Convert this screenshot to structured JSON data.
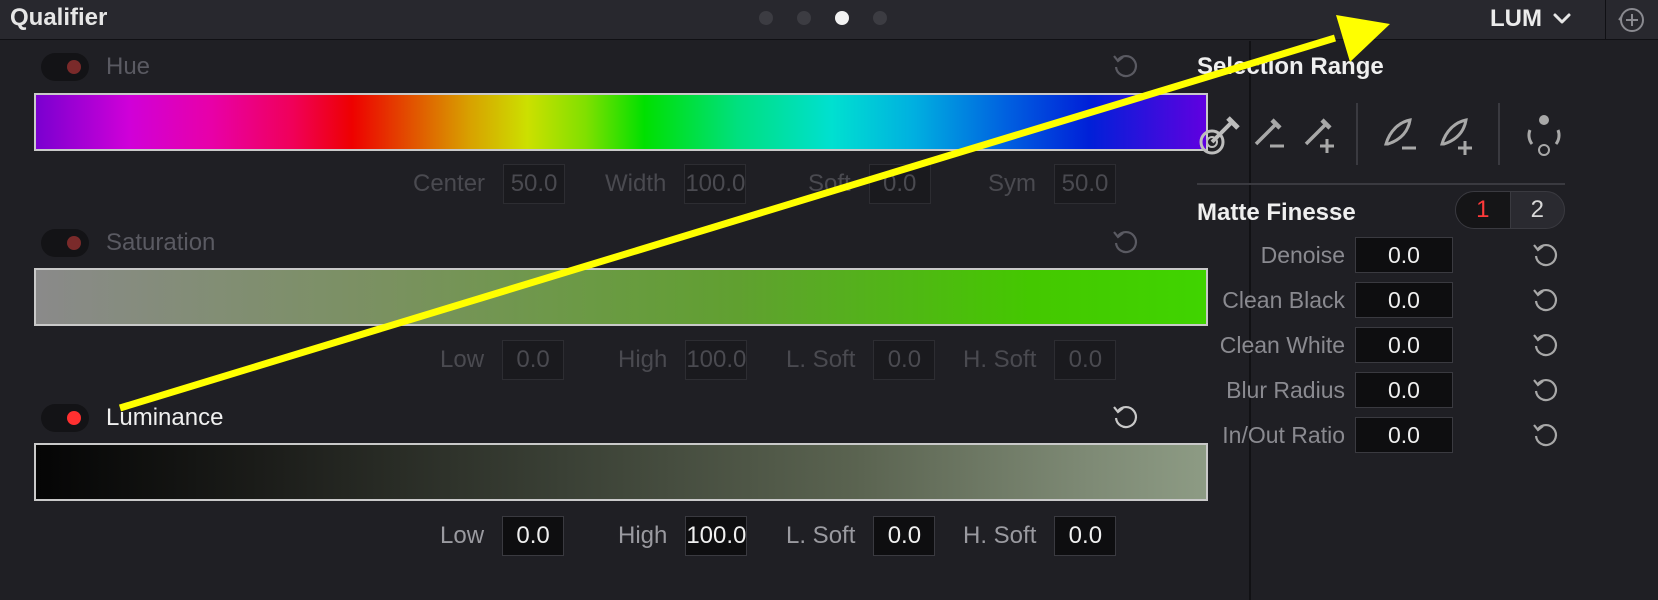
{
  "header": {
    "title": "Qualifier",
    "mode": "LUM",
    "page_dots": 4,
    "active_dot": 3
  },
  "hue": {
    "label": "Hue",
    "enabled": false,
    "params": [
      {
        "label": "Center",
        "value": "50.0"
      },
      {
        "label": "Width",
        "value": "100.0"
      },
      {
        "label": "Soft",
        "value": "0.0"
      },
      {
        "label": "Sym",
        "value": "50.0"
      }
    ]
  },
  "saturation": {
    "label": "Saturation",
    "enabled": false,
    "params": [
      {
        "label": "Low",
        "value": "0.0"
      },
      {
        "label": "High",
        "value": "100.0"
      },
      {
        "label": "L. Soft",
        "value": "0.0"
      },
      {
        "label": "H. Soft",
        "value": "0.0"
      }
    ]
  },
  "luminance": {
    "label": "Luminance",
    "enabled": true,
    "params": [
      {
        "label": "Low",
        "value": "0.0"
      },
      {
        "label": "High",
        "value": "100.0"
      },
      {
        "label": "L. Soft",
        "value": "0.0"
      },
      {
        "label": "H. Soft",
        "value": "0.0"
      }
    ]
  },
  "selection_range": {
    "title": "Selection Range",
    "tools": [
      "picker-icon",
      "picker-minus-icon",
      "picker-plus-icon",
      "feather-minus-icon",
      "feather-plus-icon",
      "invert-icon"
    ]
  },
  "matte_finesse": {
    "title": "Matte Finesse",
    "tabs": [
      "1",
      "2"
    ],
    "active_tab": "1",
    "rows": [
      {
        "label": "Denoise",
        "value": "0.0"
      },
      {
        "label": "Clean Black",
        "value": "0.0"
      },
      {
        "label": "Clean White",
        "value": "0.0"
      },
      {
        "label": "Blur Radius",
        "value": "0.0"
      },
      {
        "label": "In/Out Ratio",
        "value": "0.0"
      }
    ]
  },
  "colors": {
    "accent_red": "#ff3030",
    "annotation_arrow": "#ffff00"
  }
}
